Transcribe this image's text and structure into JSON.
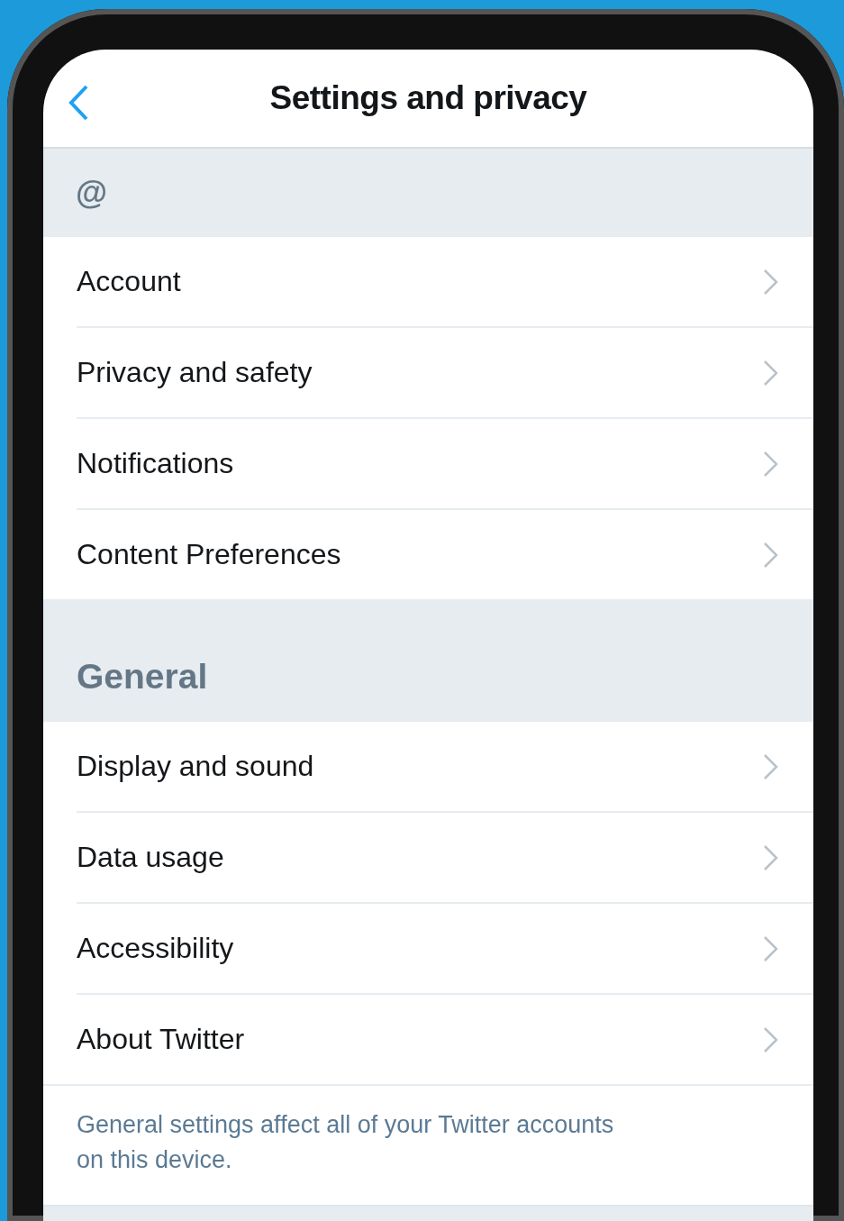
{
  "header": {
    "title": "Settings and privacy"
  },
  "account": {
    "handle": "@"
  },
  "account_items": [
    {
      "label": "Account"
    },
    {
      "label": "Privacy and safety"
    },
    {
      "label": "Notifications"
    },
    {
      "label": "Content Preferences"
    }
  ],
  "general": {
    "title": "General",
    "items": [
      {
        "label": "Display and sound"
      },
      {
        "label": "Data usage"
      },
      {
        "label": "Accessibility"
      },
      {
        "label": "About Twitter"
      }
    ],
    "footnote": "General settings affect all of your Twitter accounts on this device."
  }
}
